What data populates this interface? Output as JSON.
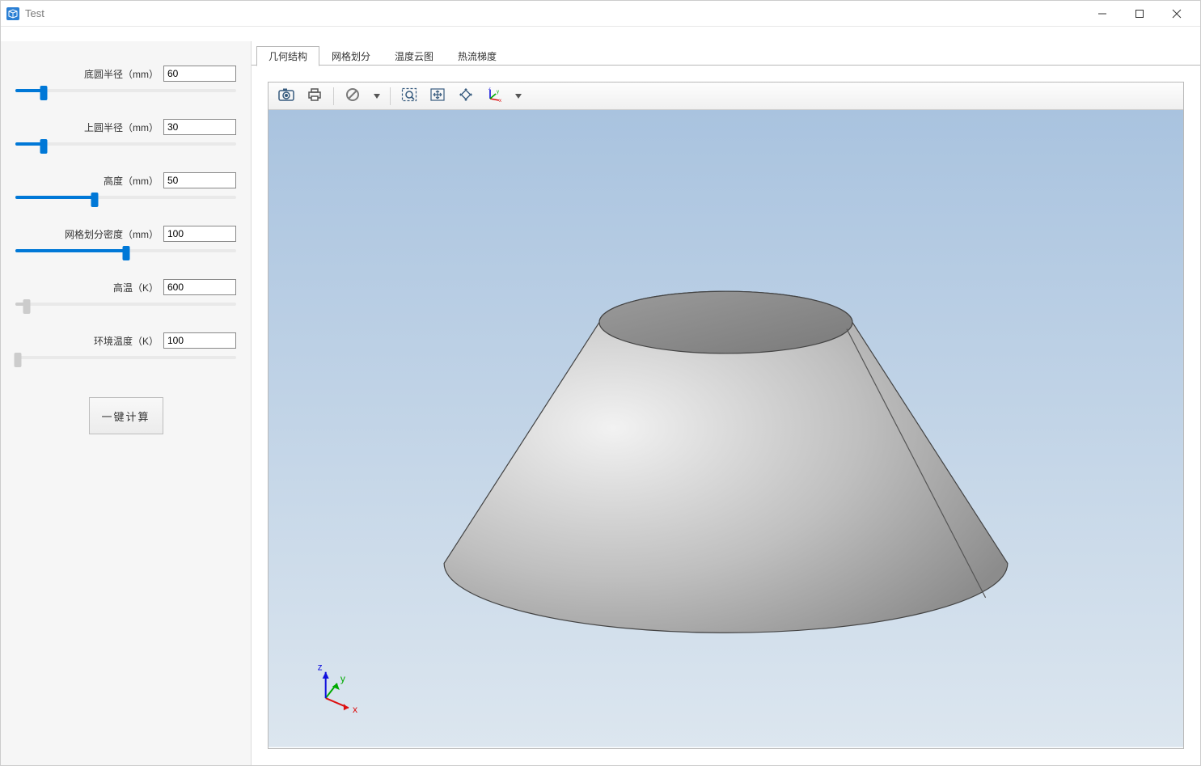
{
  "window": {
    "title": "Test"
  },
  "sidebar": {
    "params": [
      {
        "id": "bottom-radius",
        "label": "底圆半径（mm）",
        "value": "60",
        "pos": 13
      },
      {
        "id": "top-radius",
        "label": "上圆半径（mm）",
        "value": "30",
        "pos": 13
      },
      {
        "id": "height",
        "label": "高度（mm）",
        "value": "50",
        "pos": 36
      },
      {
        "id": "mesh-density",
        "label": "网格划分密度（mm）",
        "value": "100",
        "pos": 50
      },
      {
        "id": "high-temp",
        "label": "高温（K）",
        "value": "600",
        "pos": 5
      },
      {
        "id": "ambient-temp",
        "label": "环境温度（K）",
        "value": "100",
        "pos": 1
      }
    ],
    "compute_label": "一键计算"
  },
  "tabs": {
    "items": [
      {
        "id": "geometry",
        "label": "几何结构",
        "active": true
      },
      {
        "id": "mesh",
        "label": "网格划分",
        "active": false
      },
      {
        "id": "temp-map",
        "label": "温度云图",
        "active": false
      },
      {
        "id": "heat-flux",
        "label": "热流梯度",
        "active": false
      }
    ]
  },
  "toolbar": {
    "buttons": [
      "camera-icon",
      "print-icon",
      "SEP",
      "disable-icon",
      "DD",
      "SEP",
      "zoom-box-icon",
      "pan-icon",
      "fit-icon",
      "axes-icon",
      "DD"
    ]
  },
  "triad": {
    "x": "x",
    "y": "y",
    "z": "z"
  }
}
